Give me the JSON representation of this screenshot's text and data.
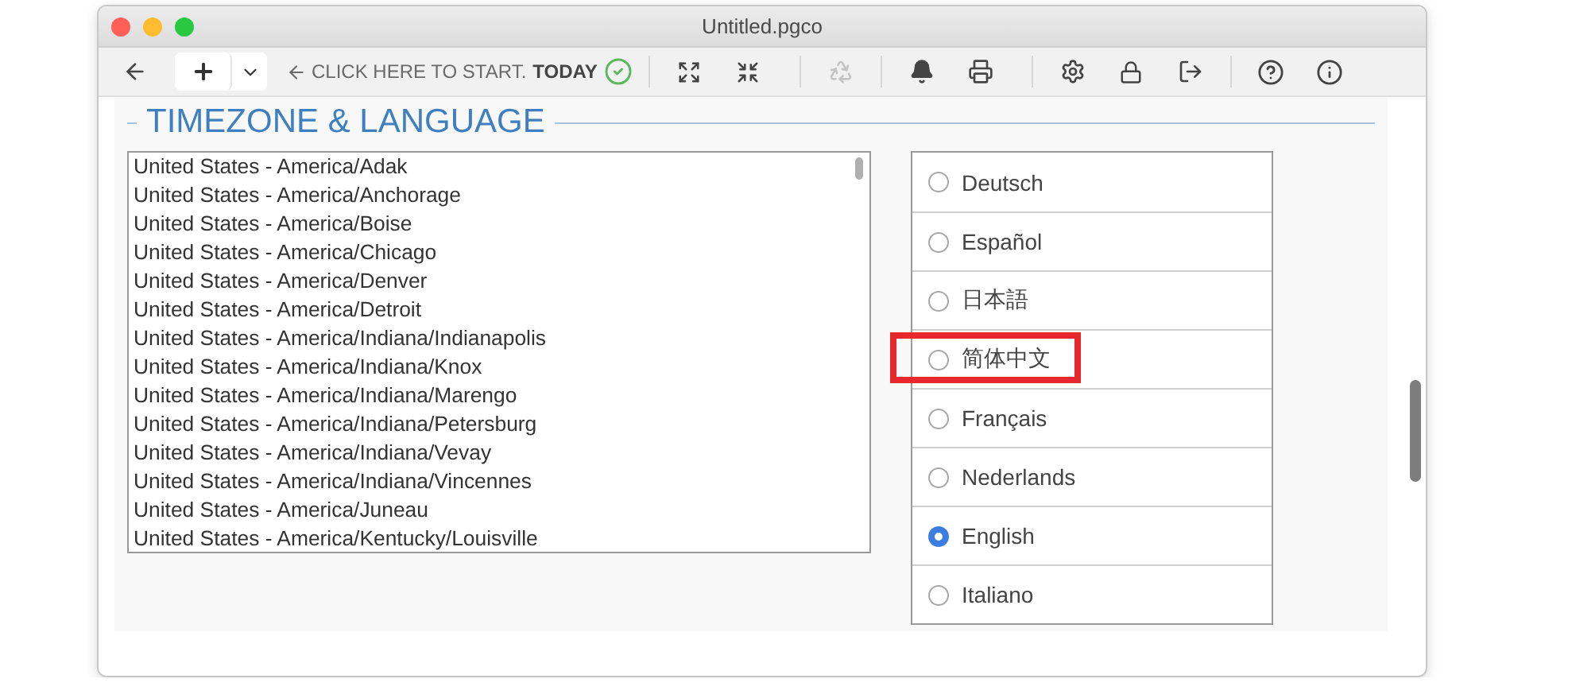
{
  "window": {
    "title": "Untitled.pgco"
  },
  "toolbar": {
    "start_hint": "CLICK HERE TO START.",
    "today": "TODAY"
  },
  "section": {
    "title": "TIMEZONE & LANGUAGE"
  },
  "timezones": [
    {
      "label": "United States - America/Adak",
      "selected": false
    },
    {
      "label": "United States - America/Anchorage",
      "selected": false
    },
    {
      "label": "United States - America/Boise",
      "selected": false
    },
    {
      "label": "United States - America/Chicago",
      "selected": false
    },
    {
      "label": "United States - America/Denver",
      "selected": false
    },
    {
      "label": "United States - America/Detroit",
      "selected": false
    },
    {
      "label": "United States - America/Indiana/Indianapolis",
      "selected": false
    },
    {
      "label": "United States - America/Indiana/Knox",
      "selected": false
    },
    {
      "label": "United States - America/Indiana/Marengo",
      "selected": false
    },
    {
      "label": "United States - America/Indiana/Petersburg",
      "selected": false
    },
    {
      "label": "United States - America/Indiana/Vevay",
      "selected": false
    },
    {
      "label": "United States - America/Indiana/Vincennes",
      "selected": false
    },
    {
      "label": "United States - America/Juneau",
      "selected": false
    },
    {
      "label": "United States - America/Kentucky/Louisville",
      "selected": false
    }
  ],
  "languages": [
    {
      "label": "Deutsch",
      "selected": false,
      "highlighted": false
    },
    {
      "label": "Español",
      "selected": false,
      "highlighted": false
    },
    {
      "label": "日本語",
      "selected": false,
      "highlighted": false
    },
    {
      "label": "简体中文",
      "selected": false,
      "highlighted": true
    },
    {
      "label": "Français",
      "selected": false,
      "highlighted": false
    },
    {
      "label": "Nederlands",
      "selected": false,
      "highlighted": false
    },
    {
      "label": "English",
      "selected": true,
      "highlighted": false
    },
    {
      "label": "Italiano",
      "selected": false,
      "highlighted": false
    }
  ]
}
